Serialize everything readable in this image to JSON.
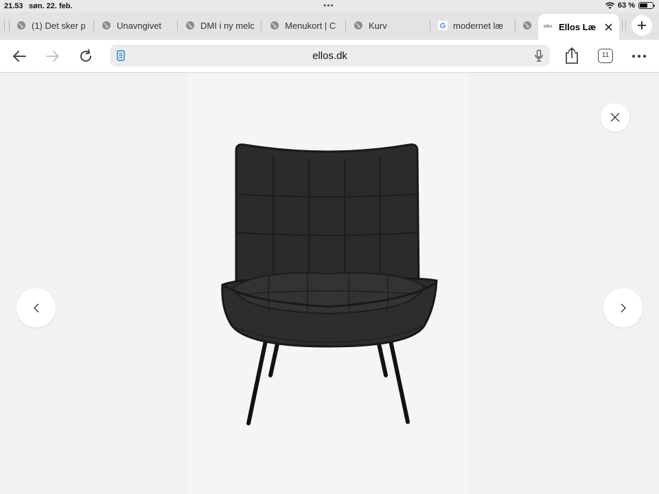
{
  "status": {
    "time": "21.53",
    "date": "søn. 22. feb.",
    "battery_text": "63 %",
    "battery_level": 0.63
  },
  "tabs": [
    {
      "label": "(1) Det sker p",
      "icon": "globe-icon"
    },
    {
      "label": "Unavngivet",
      "icon": "globe-icon"
    },
    {
      "label": "DMI i ny melc",
      "icon": "globe-icon"
    },
    {
      "label": "Menukort | C",
      "icon": "globe-icon"
    },
    {
      "label": "Kurv",
      "icon": "globe-icon"
    },
    {
      "label": "modernet læ",
      "icon": "google-icon"
    },
    {
      "label": "",
      "icon": "globe-icon"
    },
    {
      "label": "Ellos Læ",
      "icon": "ellos-favicon-icon",
      "active": true
    }
  ],
  "toolbar": {
    "url": "ellos.dk",
    "tab_count": "11"
  },
  "favicon_text": "ellos",
  "colors": {
    "page_bg": "#f2f2f2",
    "stage_bg": "#f5f5f5",
    "chair": "#2a2a2c"
  },
  "gallery": {
    "image": "black-velvet-lounge-chair"
  }
}
